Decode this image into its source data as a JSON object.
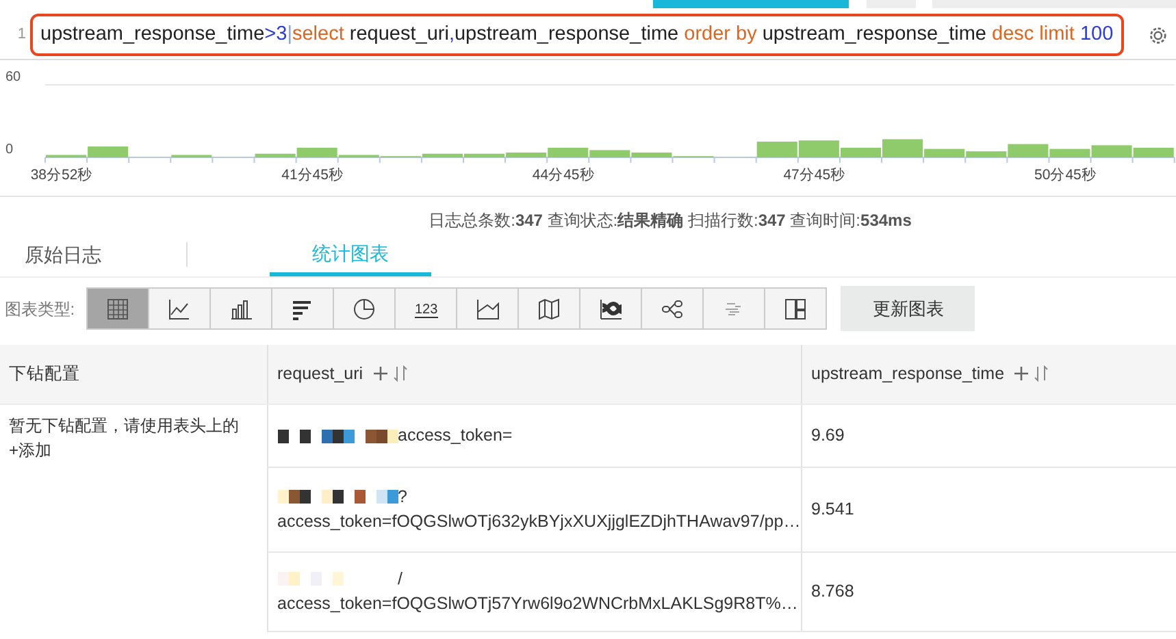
{
  "query": {
    "line_number": "1",
    "tokens": [
      {
        "text": "upstream_response_time",
        "kind": "plain"
      },
      {
        "text": ">3",
        "kind": "number"
      },
      {
        "text": "|",
        "kind": "pipe"
      },
      {
        "text": "select",
        "kind": "keyword"
      },
      {
        "text": " request_uri",
        "kind": "plain"
      },
      {
        "text": ",",
        "kind": "number"
      },
      {
        "text": "upstream_response_time ",
        "kind": "plain"
      },
      {
        "text": "order by",
        "kind": "keyword"
      },
      {
        "text": " upstream_response_time ",
        "kind": "plain"
      },
      {
        "text": "desc limit",
        "kind": "keyword"
      },
      {
        "text": " 100",
        "kind": "number"
      }
    ]
  },
  "histogram": {
    "x_labels": [
      "38分52秒",
      "41分45秒",
      "44分45秒",
      "47分45秒",
      "50分45秒"
    ],
    "chart_data": {
      "type": "bar",
      "yticks": [
        0,
        60
      ],
      "ylim": [
        0,
        60
      ],
      "series": [
        {
          "color": "#8fcb6b",
          "values": [
            2,
            9,
            null,
            2,
            null,
            3,
            8,
            2,
            1,
            3,
            3,
            4,
            8,
            6,
            4,
            1,
            null,
            13,
            14,
            8,
            15,
            7,
            5,
            11,
            7,
            10,
            8
          ]
        }
      ]
    }
  },
  "summary": "日志总条数:**347**  查询状态:**结果精确**  扫描行数:**347**  查询时间:**534ms**",
  "tabs": [
    {
      "label": "原始日志",
      "selected": false
    },
    {
      "label": "统计图表",
      "selected": true
    }
  ],
  "chart_types": {
    "label": "图表类型:",
    "items": [
      {
        "kind": "table",
        "selected": true
      },
      {
        "kind": "line",
        "selected": false
      },
      {
        "kind": "column",
        "selected": false
      },
      {
        "kind": "bar",
        "selected": false
      },
      {
        "kind": "pie",
        "selected": false
      },
      {
        "kind": "number",
        "selected": false,
        "glyph": "123"
      },
      {
        "kind": "area",
        "selected": false
      },
      {
        "kind": "map",
        "selected": false
      },
      {
        "kind": "flow",
        "selected": false
      },
      {
        "kind": "sankey",
        "selected": false
      },
      {
        "kind": "wordcloud",
        "selected": false
      },
      {
        "kind": "treemap",
        "selected": false
      }
    ],
    "update_button": "更新图表"
  },
  "drilldown": {
    "title": "下钻配置",
    "message": "暂无下钻配置，请使用表头上的+添加"
  },
  "table": {
    "columns": [
      "request_uri",
      "upstream_response_time"
    ],
    "rows": [
      {
        "uri_suffix": "access_token=",
        "value": "9.69"
      },
      {
        "uri_suffix": "?",
        "uri_line2": "access_token=fOQGSlwOTj632ykBYjxXUXjjglEZDjhTHAwav97/pp…",
        "value": "9.541"
      },
      {
        "uri_suffix": "/",
        "uri_line2": "access_token=fOQGSlwOTj57Yrw6l9o2WNCrbMxLAKLSg9R8T%…",
        "value": "8.768"
      }
    ]
  }
}
